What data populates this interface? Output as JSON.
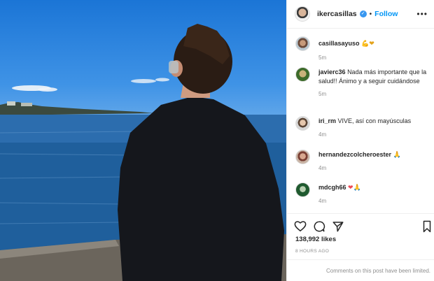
{
  "post": {
    "username": "ikercasillas",
    "follow_label": "Follow",
    "separator": "•",
    "more_label": "•••",
    "likes": "138,992 likes",
    "time_ago": "8 HOURS AGO",
    "comments_limited": "Comments on this post have been limited."
  },
  "comments": [
    {
      "user": "casillasayuso",
      "text": "",
      "emoji": "💪❤",
      "time": "5m"
    },
    {
      "user": "javierc36",
      "text": "Nada más importante que la salud!! Ánimo y a seguir cuidándose",
      "emoji": "",
      "time": "5m"
    },
    {
      "user": "iri_rm",
      "text": "VIVE, así con mayúsculas",
      "emoji": "",
      "time": "4m"
    },
    {
      "user": "hernandezcolcheroester",
      "text": "",
      "emoji": "🙏",
      "time": "4m"
    },
    {
      "user": "mdcgh66",
      "text": "",
      "emoji": "❤🙏",
      "time": "4m"
    }
  ],
  "icons": [
    "heart-icon",
    "comment-icon",
    "share-icon",
    "bookmark-icon"
  ],
  "colors": {
    "link_blue": "#0095f6",
    "verified_blue": "#3897f0",
    "muted_gray": "#8e8e8e",
    "border": "#efefef"
  }
}
